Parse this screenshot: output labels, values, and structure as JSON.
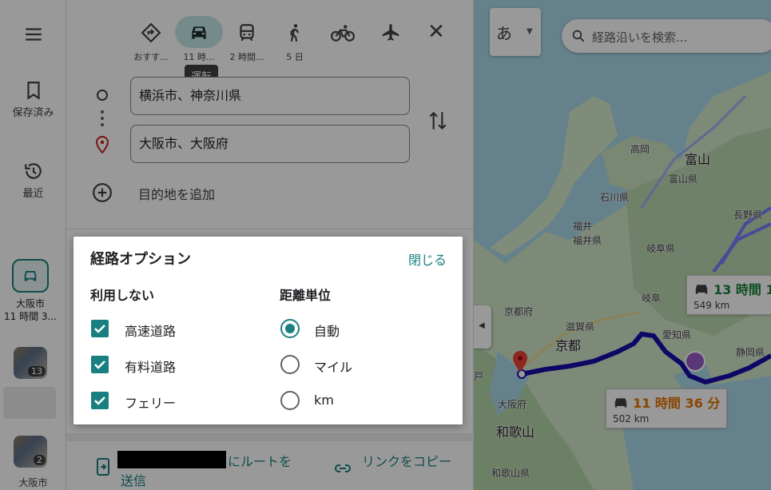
{
  "rail": {
    "menu_icon": "hamburger-icon",
    "saved_label": "保存済み",
    "recent_label": "最近",
    "route_label_line1": "大阪市",
    "route_label_line2": "11 時間 3...",
    "thumb1_count": "13",
    "thumb2_count": "2",
    "bottom_label": "大阪市"
  },
  "modes": [
    {
      "icon": "best-route-icon",
      "label": "おすす..."
    },
    {
      "icon": "car-icon",
      "label": "11 時...",
      "active": true
    },
    {
      "icon": "transit-icon",
      "label": "2 時間..."
    },
    {
      "icon": "walk-icon",
      "label": "5 日"
    },
    {
      "icon": "bicycle-icon",
      "label": ""
    },
    {
      "icon": "flight-icon",
      "label": ""
    }
  ],
  "tooltip": "運転",
  "waypoints": {
    "origin": "横浜市、神奈川県",
    "destination": "大阪市、大阪府",
    "add_destination": "目的地を追加"
  },
  "share": {
    "send_suffix": "にルートを",
    "send_line2": "送信",
    "copy_link": "リンクをコピー"
  },
  "map": {
    "ime_char": "あ",
    "search_placeholder": "経路沿いを検索...",
    "labels": {
      "takaoka": "高岡",
      "toyama": "富山",
      "toyama_pref": "富山県",
      "ishikawa_pref": "石川県",
      "fukui": "福井",
      "fukui_pref": "福井県",
      "gifu_pref": "岐阜県",
      "nagano_pref": "長野県",
      "gifu": "岐阜",
      "kyoto_pref": "京都府",
      "shiga_pref": "滋賀県",
      "kyoto": "京都",
      "aichi_pref": "愛知県",
      "shizuoka_pref": "静岡県",
      "osaka_pref": "大阪府",
      "wakayama": "和歌山",
      "wakayama_pref": "和歌山県",
      "kobe_partial": "戸"
    },
    "route_cards": [
      {
        "time": "13 時間 1",
        "distance": "549 km",
        "color": "#188038"
      },
      {
        "time": "11 時間 36 分",
        "distance": "502 km",
        "color": "#e37400"
      }
    ],
    "route_color": "#1a0dab"
  },
  "options": {
    "title": "経路オプション",
    "close": "閉じる",
    "avoid_header": "利用しない",
    "avoid": [
      {
        "label": "高速道路",
        "checked": true
      },
      {
        "label": "有料道路",
        "checked": true
      },
      {
        "label": "フェリー",
        "checked": true
      }
    ],
    "units_header": "距離単位",
    "units": [
      {
        "label": "自動",
        "selected": true
      },
      {
        "label": "マイル",
        "selected": false
      },
      {
        "label": "km",
        "selected": false
      }
    ]
  }
}
